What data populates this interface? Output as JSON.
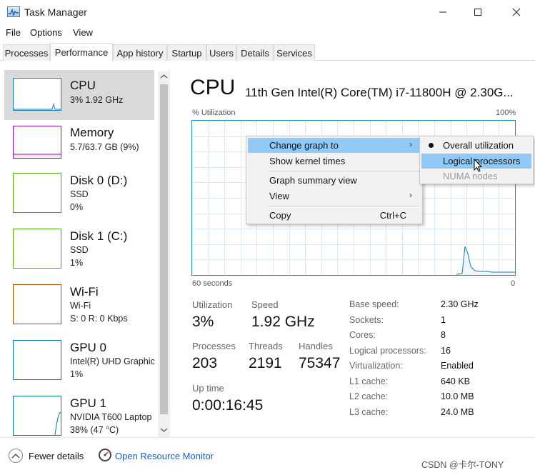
{
  "window": {
    "title": "Task Manager",
    "icon": "task-manager-icon",
    "controls": [
      "minimize-icon",
      "maximize-icon",
      "close-icon"
    ]
  },
  "menu": {
    "file": "File",
    "options": "Options",
    "view": "View"
  },
  "tabs": [
    "Processes",
    "Performance",
    "App history",
    "Startup",
    "Users",
    "Details",
    "Services"
  ],
  "active_tab": "Performance",
  "sidebar": {
    "items": [
      {
        "name": "CPU",
        "line1": "3% 1.92 GHz",
        "line2": "",
        "color": "#117dbb"
      },
      {
        "name": "Memory",
        "line1": "5.7/63.7 GB (9%)",
        "line2": "",
        "color": "#8b12ae"
      },
      {
        "name": "Disk 0 (D:)",
        "line1": "SSD",
        "line2": "0%",
        "color": "#4da60c"
      },
      {
        "name": "Disk 1 (C:)",
        "line1": "SSD",
        "line2": "1%",
        "color": "#4da60c"
      },
      {
        "name": "Wi-Fi",
        "line1": "Wi-Fi",
        "line2": "S: 0 R: 0 Kbps",
        "color": "#a74f01"
      },
      {
        "name": "GPU 0",
        "line1": "Intel(R) UHD Graphic",
        "line2": "1%",
        "color": "#0078a8"
      },
      {
        "name": "GPU 1",
        "line1": "NVIDIA T600 Laptop",
        "line2": "38% (47 °C)",
        "color": "#0078a8"
      }
    ]
  },
  "cpu": {
    "title": "CPU",
    "model": "11th Gen Intel(R) Core(TM) i7-11800H @ 2.30G...",
    "graph_label": "% Utilization",
    "graph_max": "100%",
    "graph_span": "60 seconds",
    "graph_min": "0",
    "graph_color": "#117dbb",
    "stats": {
      "utilization_label": "Utilization",
      "utilization": "3%",
      "speed_label": "Speed",
      "speed": "1.92 GHz",
      "processes_label": "Processes",
      "processes": "203",
      "threads_label": "Threads",
      "threads": "2191",
      "handles_label": "Handles",
      "handles": "75347",
      "uptime_label": "Up time",
      "uptime": "0:00:16:45"
    },
    "specs": [
      {
        "label": "Base speed:",
        "value": "2.30 GHz"
      },
      {
        "label": "Sockets:",
        "value": "1"
      },
      {
        "label": "Cores:",
        "value": "8"
      },
      {
        "label": "Logical processors:",
        "value": "16"
      },
      {
        "label": "Virtualization:",
        "value": "Enabled"
      },
      {
        "label": "L1 cache:",
        "value": "640 KB"
      },
      {
        "label": "L2 cache:",
        "value": "10.0 MB"
      },
      {
        "label": "L3 cache:",
        "value": "24.0 MB"
      }
    ]
  },
  "context_menu": {
    "change_graph": "Change graph to",
    "show_kernel": "Show kernel times",
    "summary_view": "Graph summary view",
    "view": "View",
    "copy": "Copy",
    "copy_shortcut": "Ctrl+C"
  },
  "submenu": {
    "overall": "Overall utilization",
    "logical": "Logical processors",
    "numa": "NUMA nodes"
  },
  "footer": {
    "fewer_details": "Fewer details",
    "resource_monitor": "Open Resource Monitor"
  },
  "watermark": "CSDN @卡尔-TONY"
}
